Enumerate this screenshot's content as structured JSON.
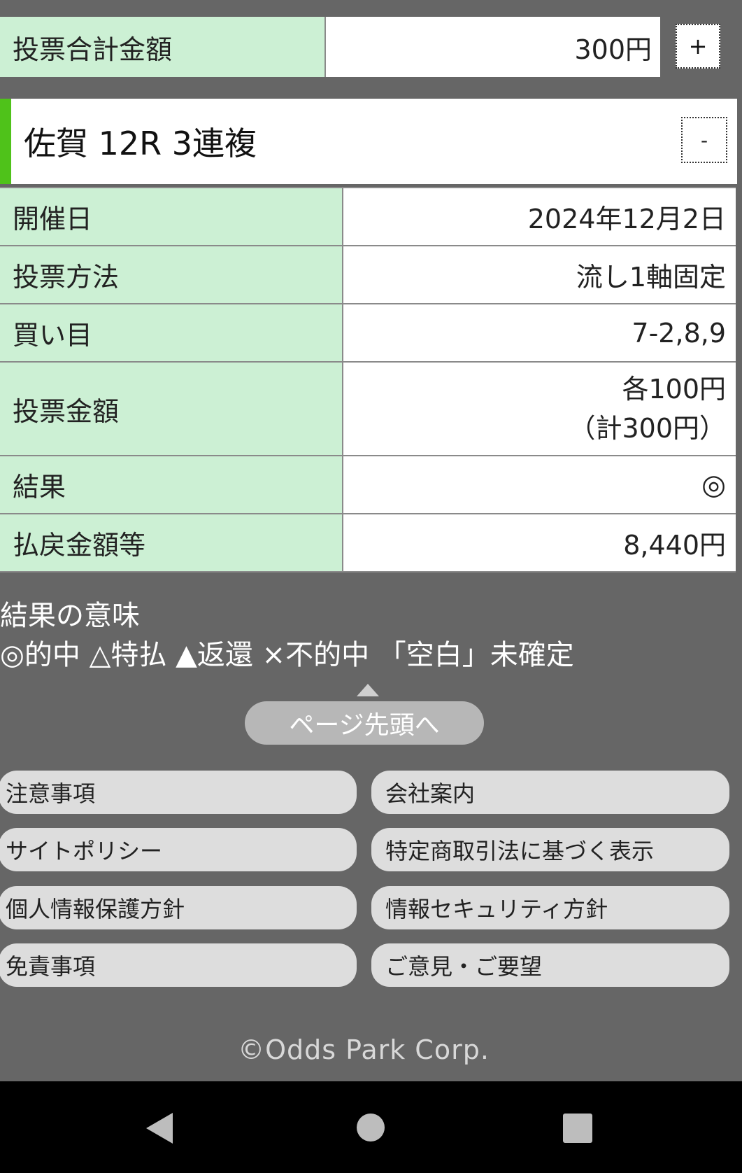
{
  "total": {
    "label": "投票合計金額",
    "value": "300円",
    "expand_label": "+"
  },
  "race": {
    "title": "佐賀 12R 3連複",
    "collapse_label": "-",
    "accent_color": "#4fc21a"
  },
  "details": [
    {
      "label": "開催日",
      "value": "2024年12月2日"
    },
    {
      "label": "投票方法",
      "value": "流し1軸固定"
    },
    {
      "label": "買い目",
      "value": "7-2,8,9"
    },
    {
      "label": "投票金額",
      "value": "各100円",
      "value2": "（計300円）"
    },
    {
      "label": "結果",
      "value": "◎"
    },
    {
      "label": "払戻金額等",
      "value": "8,440円"
    }
  ],
  "legend": {
    "title": "結果の意味",
    "items": "◎的中 △特払 ▲返還 ×不的中 「空白」未確定"
  },
  "page_top_label": "ページ先頭へ",
  "footer_links": [
    "注意事項",
    "会社案内",
    "サイトポリシー",
    "特定商取引法に基づく表示",
    "個人情報保護方針",
    "情報セキュリティ方針",
    "免責事項",
    "ご意見・ご要望"
  ],
  "copyright": "©Odds Park Corp.",
  "colors": {
    "label_bg": "#ccf0d4",
    "page_bg": "#666666"
  }
}
